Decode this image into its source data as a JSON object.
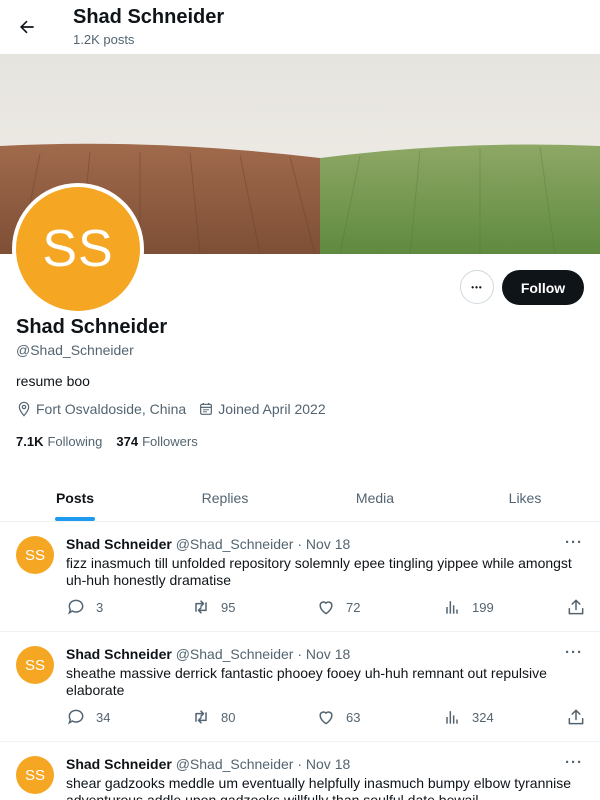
{
  "header": {
    "name": "Shad Schneider",
    "post_count": "1.2K posts"
  },
  "profile": {
    "avatar_initials": "SS",
    "avatar_color": "#f5a623",
    "name": "Shad Schneider",
    "handle": "@Shad_Schneider",
    "bio": "resume boo",
    "location": "Fort Osvaldoside, China",
    "joined": "Joined April 2022",
    "following_count": "7.1K",
    "following_label": "Following",
    "followers_count": "374",
    "followers_label": "Followers",
    "follow_label": "Follow",
    "more_label": "•••"
  },
  "tabs": [
    {
      "label": "Posts"
    },
    {
      "label": "Replies"
    },
    {
      "label": "Media"
    },
    {
      "label": "Likes"
    }
  ],
  "posts": [
    {
      "avatar": "SS",
      "name": "Shad Schneider",
      "handle": "@Shad_Schneider",
      "date": "Nov 18",
      "text": "fizz inasmuch till unfolded repository solemnly epee tingling yippee while amongst uh-huh honestly dramatise",
      "replies": "3",
      "reposts": "95",
      "likes": "72",
      "views": "199"
    },
    {
      "avatar": "SS",
      "name": "Shad Schneider",
      "handle": "@Shad_Schneider",
      "date": "Nov 18",
      "text": "sheathe massive derrick fantastic phooey fooey uh-huh remnant out repulsive elaborate",
      "replies": "34",
      "reposts": "80",
      "likes": "63",
      "views": "324"
    },
    {
      "avatar": "SS",
      "name": "Shad Schneider",
      "handle": "@Shad_Schneider",
      "date": "Nov 18",
      "text": "shear gadzooks meddle um eventually helpfully inasmuch bumpy elbow tyrannise adventurous addle upon gadzooks willfully than soulful date bewail",
      "replies": "",
      "reposts": "",
      "likes": "",
      "views": ""
    }
  ],
  "colors": {
    "accent": "#1d9bf0",
    "text": "#0f1419",
    "muted": "#536471"
  },
  "icons": [
    "back-arrow-icon",
    "location-icon",
    "calendar-icon",
    "reply-icon",
    "repost-icon",
    "like-icon",
    "views-icon",
    "share-icon"
  ]
}
